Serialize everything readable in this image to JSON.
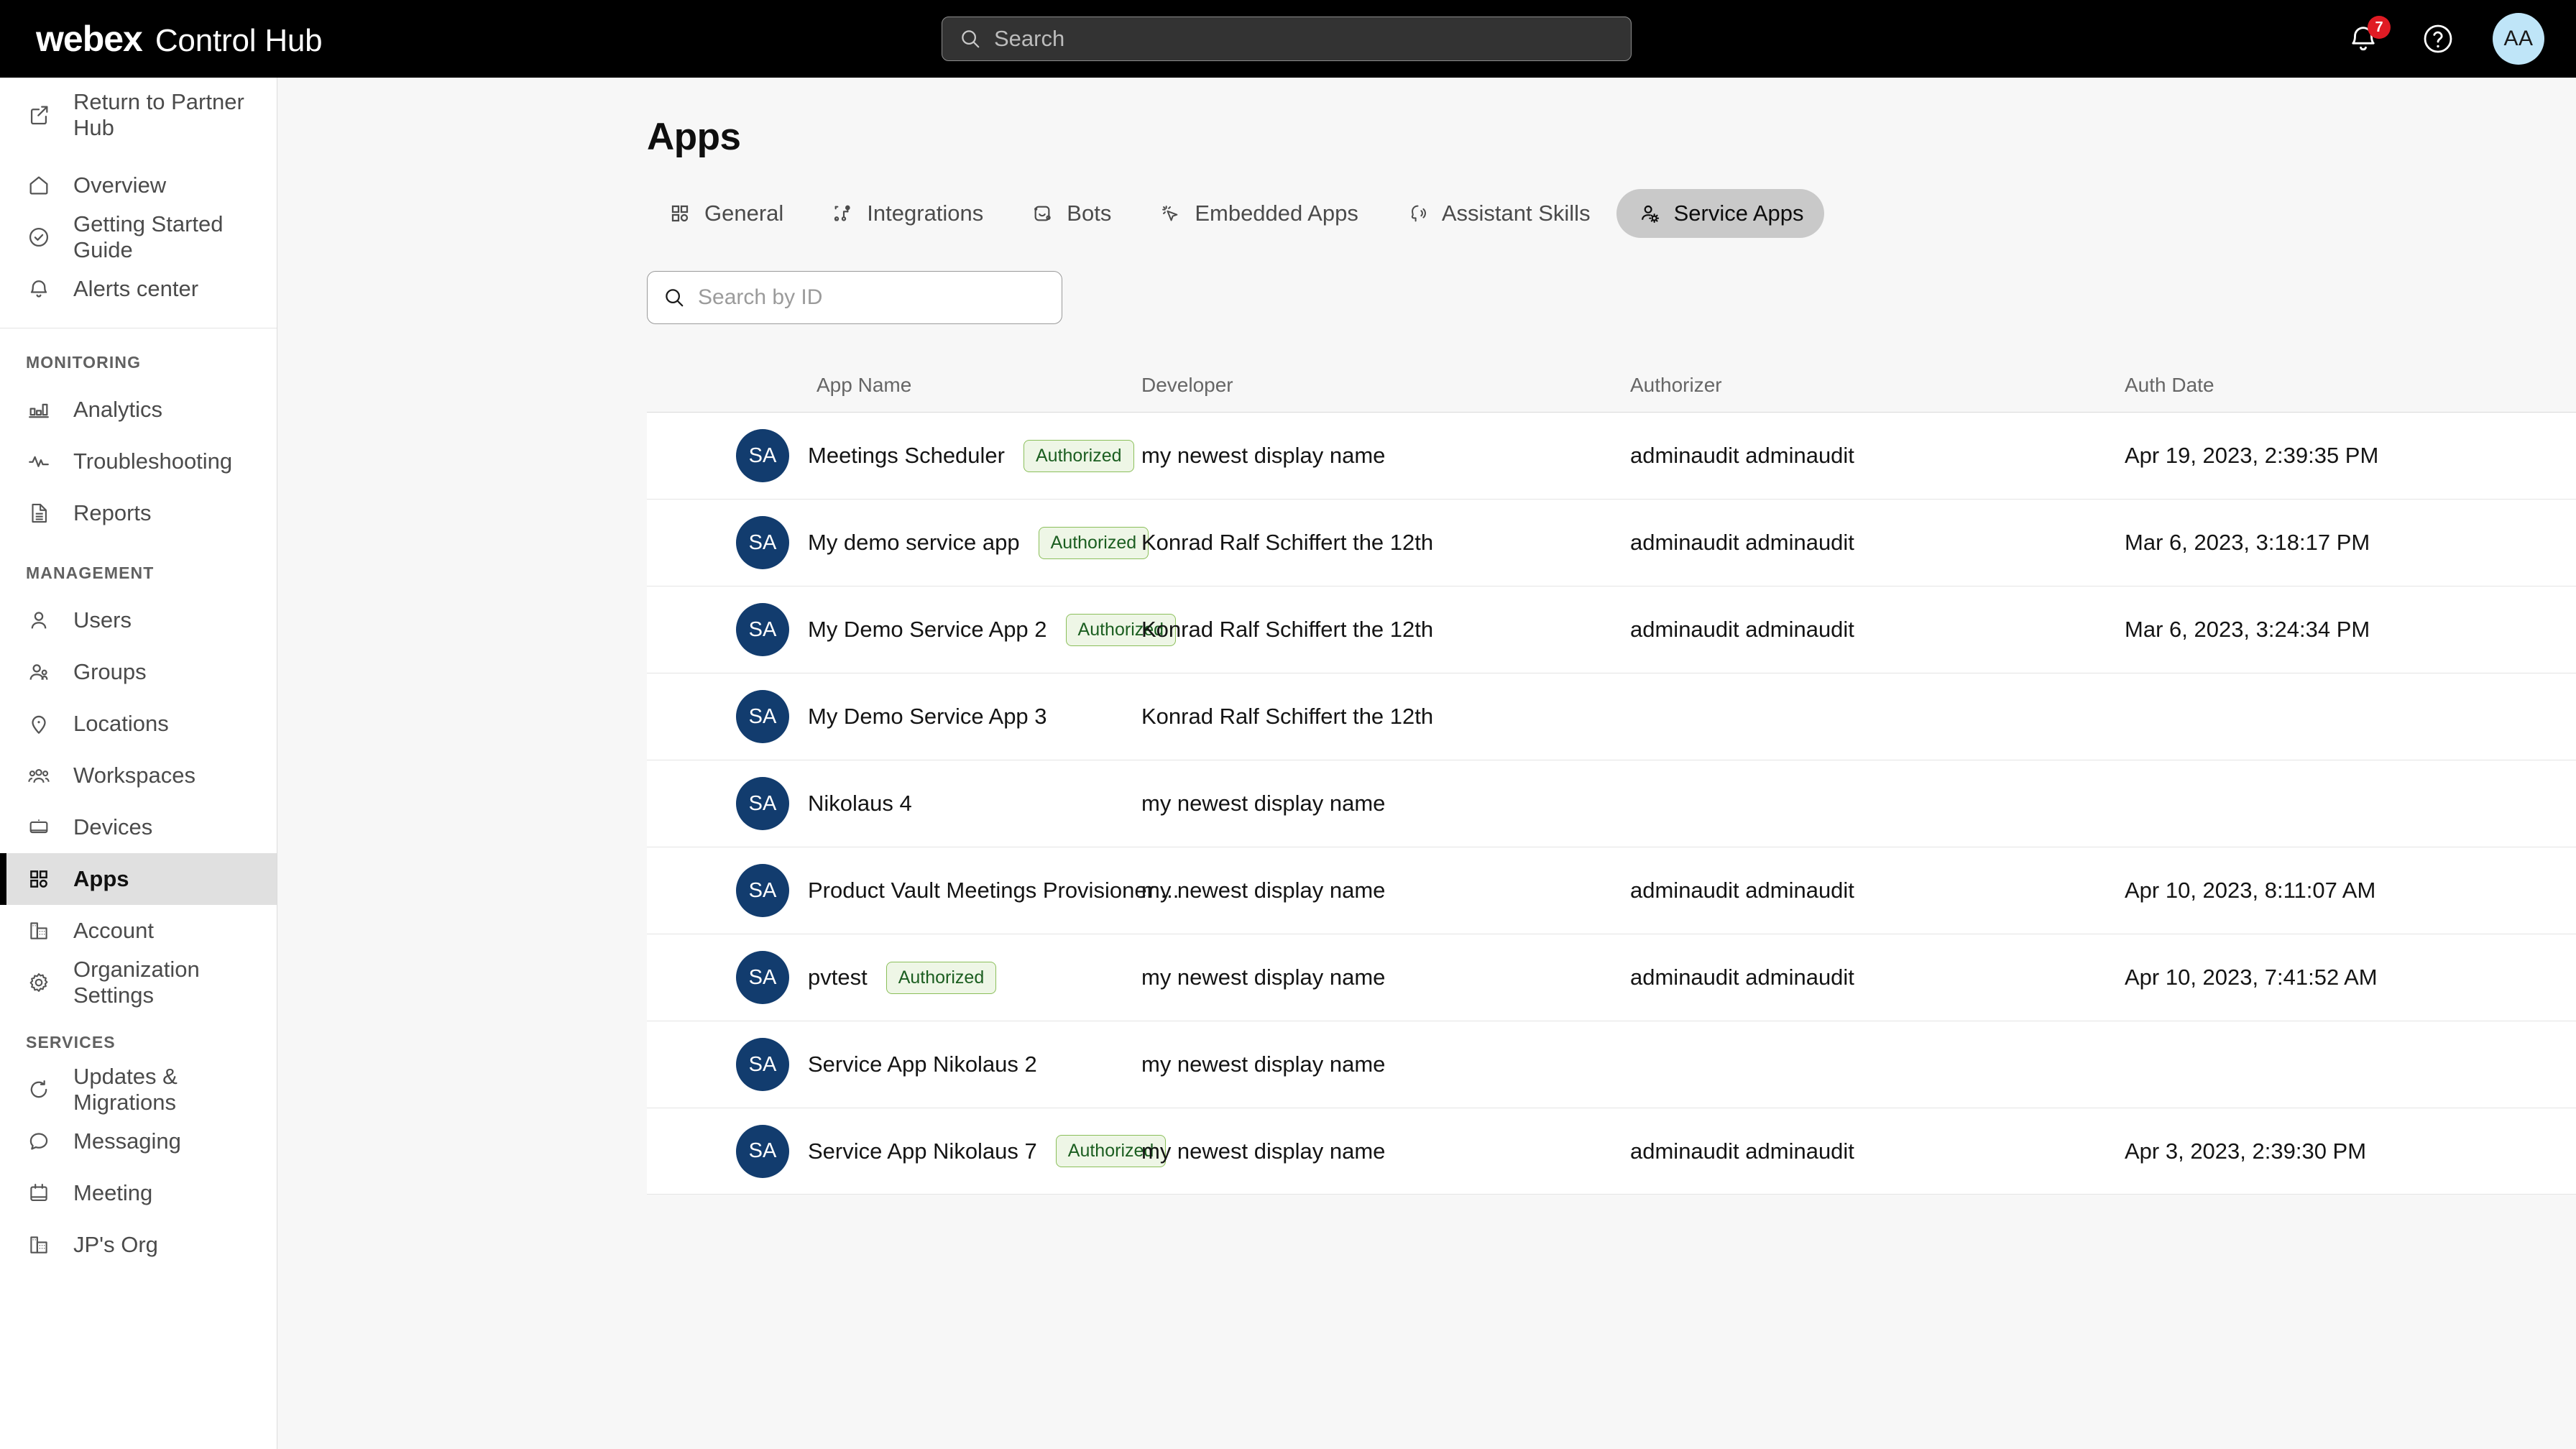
{
  "topbar": {
    "brand_webex": "webex",
    "brand_product": "Control Hub",
    "search_placeholder": "Search",
    "notification_count": "7",
    "avatar_initials": "AA"
  },
  "sidebar": {
    "top_items": [
      {
        "label": "Return to Partner Hub",
        "icon": "external-link-icon"
      }
    ],
    "primary_items": [
      {
        "label": "Overview",
        "icon": "home-icon"
      },
      {
        "label": "Getting Started Guide",
        "icon": "check-circle-icon"
      },
      {
        "label": "Alerts center",
        "icon": "bell-icon"
      }
    ],
    "sections": [
      {
        "title": "MONITORING",
        "items": [
          {
            "label": "Analytics",
            "icon": "bar-chart-icon"
          },
          {
            "label": "Troubleshooting",
            "icon": "pulse-icon"
          },
          {
            "label": "Reports",
            "icon": "document-icon"
          }
        ]
      },
      {
        "title": "MANAGEMENT",
        "items": [
          {
            "label": "Users",
            "icon": "user-icon"
          },
          {
            "label": "Groups",
            "icon": "users-group-icon"
          },
          {
            "label": "Locations",
            "icon": "map-pin-icon"
          },
          {
            "label": "Workspaces",
            "icon": "workspaces-icon"
          },
          {
            "label": "Devices",
            "icon": "device-icon"
          },
          {
            "label": "Apps",
            "icon": "apps-grid-icon",
            "active": true
          },
          {
            "label": "Account",
            "icon": "building-icon"
          },
          {
            "label": "Organization Settings",
            "icon": "gear-icon"
          }
        ]
      },
      {
        "title": "SERVICES",
        "items": [
          {
            "label": "Updates & Migrations",
            "icon": "refresh-icon"
          },
          {
            "label": "Messaging",
            "icon": "chat-bubble-icon"
          },
          {
            "label": "Meeting",
            "icon": "calendar-icon"
          },
          {
            "label": "JP's Org",
            "icon": "building-icon"
          }
        ]
      }
    ]
  },
  "main": {
    "page_title": "Apps",
    "tabs": [
      {
        "label": "General",
        "icon": "apps-grid-icon",
        "active": false
      },
      {
        "label": "Integrations",
        "icon": "integrations-icon",
        "active": false
      },
      {
        "label": "Bots",
        "icon": "bot-icon",
        "active": false
      },
      {
        "label": "Embedded Apps",
        "icon": "cursor-click-icon",
        "active": false
      },
      {
        "label": "Assistant Skills",
        "icon": "assistant-icon",
        "active": false
      },
      {
        "label": "Service Apps",
        "icon": "user-gear-icon",
        "active": true
      }
    ],
    "id_search_placeholder": "Search by ID",
    "table": {
      "columns": [
        "App Name",
        "Developer",
        "Authorizer",
        "Auth Date"
      ],
      "rows": [
        {
          "avatar": "SA",
          "app_name": "Meetings Scheduler",
          "status": "Authorized",
          "developer": "my newest display name",
          "authorizer": "adminaudit adminaudit",
          "auth_date": "Apr 19, 2023, 2:39:35 PM"
        },
        {
          "avatar": "SA",
          "app_name": "My demo service app",
          "status": "Authorized",
          "developer": "Konrad Ralf Schiffert the 12th",
          "authorizer": "adminaudit adminaudit",
          "auth_date": "Mar 6, 2023, 3:18:17 PM"
        },
        {
          "avatar": "SA",
          "app_name": "My Demo Service App 2",
          "status": "Authorized",
          "developer": "Konrad Ralf Schiffert the 12th",
          "authorizer": "adminaudit adminaudit",
          "auth_date": "Mar 6, 2023, 3:24:34 PM"
        },
        {
          "avatar": "SA",
          "app_name": "My Demo Service App 3",
          "status": "",
          "developer": "Konrad Ralf Schiffert the 12th",
          "authorizer": "",
          "auth_date": ""
        },
        {
          "avatar": "SA",
          "app_name": "Nikolaus 4",
          "status": "",
          "developer": "my newest display name",
          "authorizer": "",
          "auth_date": ""
        },
        {
          "avatar": "SA",
          "app_name": "Product Vault Meetings Provisioner ...",
          "status": "",
          "developer": "my newest display name",
          "authorizer": "adminaudit adminaudit",
          "auth_date": "Apr 10, 2023, 8:11:07 AM"
        },
        {
          "avatar": "SA",
          "app_name": "pvtest",
          "status": "Authorized",
          "developer": "my newest display name",
          "authorizer": "adminaudit adminaudit",
          "auth_date": "Apr 10, 2023, 7:41:52 AM"
        },
        {
          "avatar": "SA",
          "app_name": "Service App Nikolaus 2",
          "status": "",
          "developer": "my newest display name",
          "authorizer": "",
          "auth_date": ""
        },
        {
          "avatar": "SA",
          "app_name": "Service App Nikolaus 7",
          "status": "Authorized",
          "developer": "my newest display name",
          "authorizer": "adminaudit adminaudit",
          "auth_date": "Apr 3, 2023, 2:39:30 PM"
        }
      ]
    }
  },
  "colors": {
    "topbar_bg": "#000000",
    "avatar_app": "#123c6e",
    "avatar_user": "#bfe5f8",
    "badge_notification": "#e01b24",
    "status_text": "#1b5e20",
    "status_bg": "#eef6e6",
    "status_border": "#8bbf5a",
    "active_nav_bg": "#e0e0e0",
    "active_tab_bg": "#c9c9c9"
  }
}
